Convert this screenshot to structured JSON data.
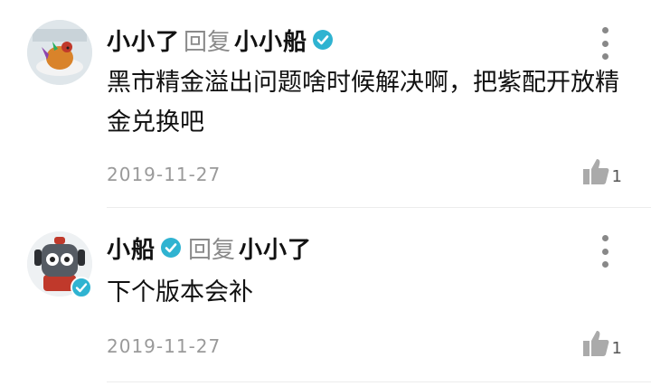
{
  "comments": [
    {
      "author": "小小了",
      "reply_word": "回复",
      "reply_to": "小小船",
      "body": "黑市精金溢出问题啥时候解决啊，把紫配开放精金兑换吧",
      "date": "2019-11-27",
      "likes": "1",
      "avatar_icon": "rooster-dish-avatar",
      "author_verified": false,
      "reply_to_verified": true
    },
    {
      "author": "小船",
      "reply_word": "回复",
      "reply_to": "小小了",
      "body": "下个版本会补",
      "date": "2019-11-27",
      "likes": "1",
      "avatar_icon": "cartoon-robot-avatar",
      "author_verified": true,
      "reply_to_verified": false
    }
  ],
  "colors": {
    "verified": "#2fb3d1",
    "meta_text": "#9a9a9a",
    "primary_text": "#111111"
  }
}
